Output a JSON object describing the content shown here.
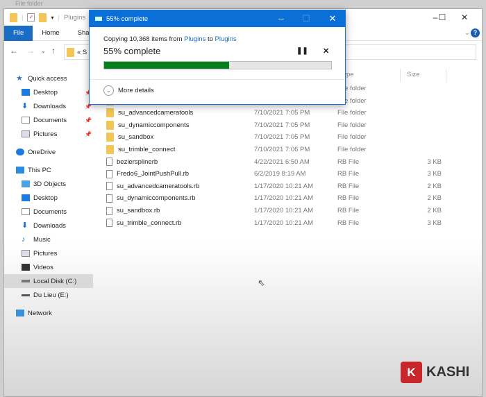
{
  "background_text": "File folder",
  "explorer": {
    "title": "Plugins",
    "tabs": [
      "File",
      "Home",
      "Share"
    ],
    "address": "« S",
    "column_size": "Size",
    "column_type": "Type"
  },
  "sidebar": {
    "items": [
      {
        "label": "Quick access",
        "icon": "star-icon",
        "level": 0,
        "pinned": false
      },
      {
        "label": "Desktop",
        "icon": "desktop-icon",
        "level": 1,
        "pinned": true
      },
      {
        "label": "Downloads",
        "icon": "download-icon",
        "level": 1,
        "pinned": true
      },
      {
        "label": "Documents",
        "icon": "document-icon",
        "level": 1,
        "pinned": true
      },
      {
        "label": "Pictures",
        "icon": "picture-icon",
        "level": 1,
        "pinned": true
      },
      {
        "label": "OneDrive",
        "icon": "cloud-icon",
        "level": 0,
        "pinned": false
      },
      {
        "label": "This PC",
        "icon": "computer-icon",
        "level": 0,
        "pinned": false
      },
      {
        "label": "3D Objects",
        "icon": "cube-icon",
        "level": 1,
        "pinned": false
      },
      {
        "label": "Desktop",
        "icon": "desktop-icon",
        "level": 1,
        "pinned": false
      },
      {
        "label": "Documents",
        "icon": "document-icon",
        "level": 1,
        "pinned": false
      },
      {
        "label": "Downloads",
        "icon": "download-icon",
        "level": 1,
        "pinned": false
      },
      {
        "label": "Music",
        "icon": "music-icon",
        "level": 1,
        "pinned": false
      },
      {
        "label": "Pictures",
        "icon": "picture-icon",
        "level": 1,
        "pinned": false
      },
      {
        "label": "Videos",
        "icon": "video-icon",
        "level": 1,
        "pinned": false
      },
      {
        "label": "Local Disk (C:)",
        "icon": "disk-icon",
        "level": 1,
        "pinned": false,
        "selected": true
      },
      {
        "label": "Du Lieu (E:)",
        "icon": "drive-icon",
        "level": 1,
        "pinned": false
      },
      {
        "label": "Network",
        "icon": "network-icon",
        "level": 0,
        "pinned": false
      }
    ]
  },
  "files": [
    {
      "name": "",
      "date": "",
      "type": "File folder",
      "size": "",
      "kind": "folder"
    },
    {
      "name": "",
      "date": "",
      "type": "File folder",
      "size": "",
      "kind": "folder"
    },
    {
      "name": "su_advancedcameratools",
      "date": "7/10/2021 7:05 PM",
      "type": "File folder",
      "size": "",
      "kind": "folder"
    },
    {
      "name": "su_dynamiccomponents",
      "date": "7/10/2021 7:05 PM",
      "type": "File folder",
      "size": "",
      "kind": "folder"
    },
    {
      "name": "su_sandbox",
      "date": "7/10/2021 7:05 PM",
      "type": "File folder",
      "size": "",
      "kind": "folder"
    },
    {
      "name": "su_trimble_connect",
      "date": "7/10/2021 7:06 PM",
      "type": "File folder",
      "size": "",
      "kind": "folder"
    },
    {
      "name": "beziersplinerb",
      "date": "4/22/2021 6:50 AM",
      "type": "RB File",
      "size": "3 KB",
      "kind": "file"
    },
    {
      "name": "Fredo6_JointPushPull.rb",
      "date": "6/2/2019 8:19 AM",
      "type": "RB File",
      "size": "3 KB",
      "kind": "file"
    },
    {
      "name": "su_advancedcameratools.rb",
      "date": "1/17/2020 10:21 AM",
      "type": "RB File",
      "size": "2 KB",
      "kind": "file"
    },
    {
      "name": "su_dynamiccomponents.rb",
      "date": "1/17/2020 10:21 AM",
      "type": "RB File",
      "size": "2 KB",
      "kind": "file"
    },
    {
      "name": "su_sandbox.rb",
      "date": "1/17/2020 10:21 AM",
      "type": "RB File",
      "size": "2 KB",
      "kind": "file"
    },
    {
      "name": "su_trimble_connect.rb",
      "date": "1/17/2020 10:21 AM",
      "type": "RB File",
      "size": "3 KB",
      "kind": "file"
    }
  ],
  "dialog": {
    "title": "55% complete",
    "copy_prefix": "Copying 10,368 items from ",
    "source": "Plugins",
    "copy_mid": " to ",
    "dest": "Plugins",
    "status": "55% complete",
    "progress_percent": 55,
    "more_details": "More details",
    "accent": "#0b6fd8",
    "progress_color": "#06801f"
  },
  "watermark": {
    "letter": "K",
    "text": "KASHI"
  }
}
